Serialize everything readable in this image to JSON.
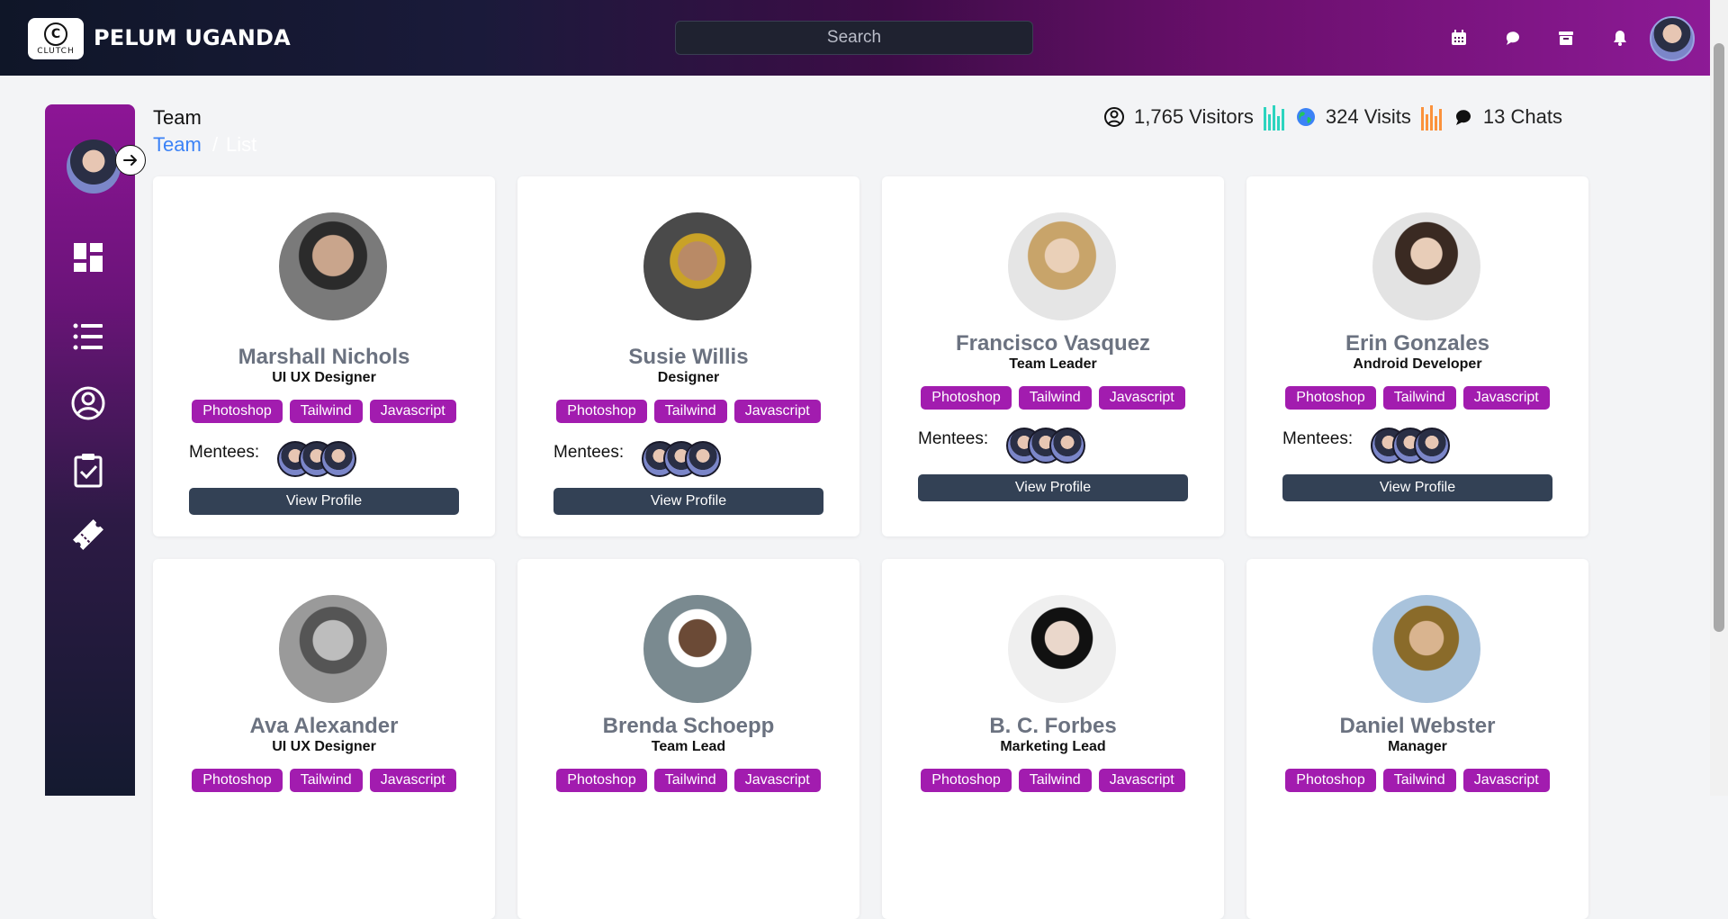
{
  "brand": {
    "logo_text": "CLUTCH",
    "name": "PELUM UGANDA"
  },
  "search": {
    "placeholder": "Search"
  },
  "page": {
    "title": "Team",
    "breadcrumb": [
      "Team",
      "/",
      "List"
    ]
  },
  "stats": {
    "visitors": "1,765 Visitors",
    "visits": "324 Visits",
    "chats": "13 Chats"
  },
  "top_icons": [
    "calendar-icon",
    "chat-icon",
    "archive-icon",
    "bell-icon"
  ],
  "sidebar_icons": [
    "dashboard-icon",
    "list-icon",
    "user-circle-icon",
    "clipboard-check-icon",
    "ticket-icon"
  ],
  "colors": {
    "tag": "#a21caf",
    "button": "#334155",
    "link": "#3b82f6",
    "name": "#6b7280"
  },
  "mentees_label": "Mentees:",
  "view_profile_label": "View Profile",
  "team": [
    {
      "name": "Marshall Nichols",
      "role": "UI UX Designer",
      "skills": [
        "Photoshop",
        "Tailwind",
        "Javascript"
      ]
    },
    {
      "name": "Susie Willis",
      "role": "Designer",
      "skills": [
        "Photoshop",
        "Tailwind",
        "Javascript"
      ]
    },
    {
      "name": "Francisco Vasquez",
      "role": "Team Leader",
      "skills": [
        "Photoshop",
        "Tailwind",
        "Javascript"
      ]
    },
    {
      "name": "Erin Gonzales",
      "role": "Android Developer",
      "skills": [
        "Photoshop",
        "Tailwind",
        "Javascript"
      ]
    },
    {
      "name": "Ava Alexander",
      "role": "UI UX Designer",
      "skills": [
        "Photoshop",
        "Tailwind",
        "Javascript"
      ]
    },
    {
      "name": "Brenda Schoepp",
      "role": "Team Lead",
      "skills": [
        "Photoshop",
        "Tailwind",
        "Javascript"
      ]
    },
    {
      "name": "B. C. Forbes",
      "role": "Marketing Lead",
      "skills": [
        "Photoshop",
        "Tailwind",
        "Javascript"
      ]
    },
    {
      "name": "Daniel Webster",
      "role": "Manager",
      "skills": [
        "Photoshop",
        "Tailwind",
        "Javascript"
      ]
    }
  ]
}
